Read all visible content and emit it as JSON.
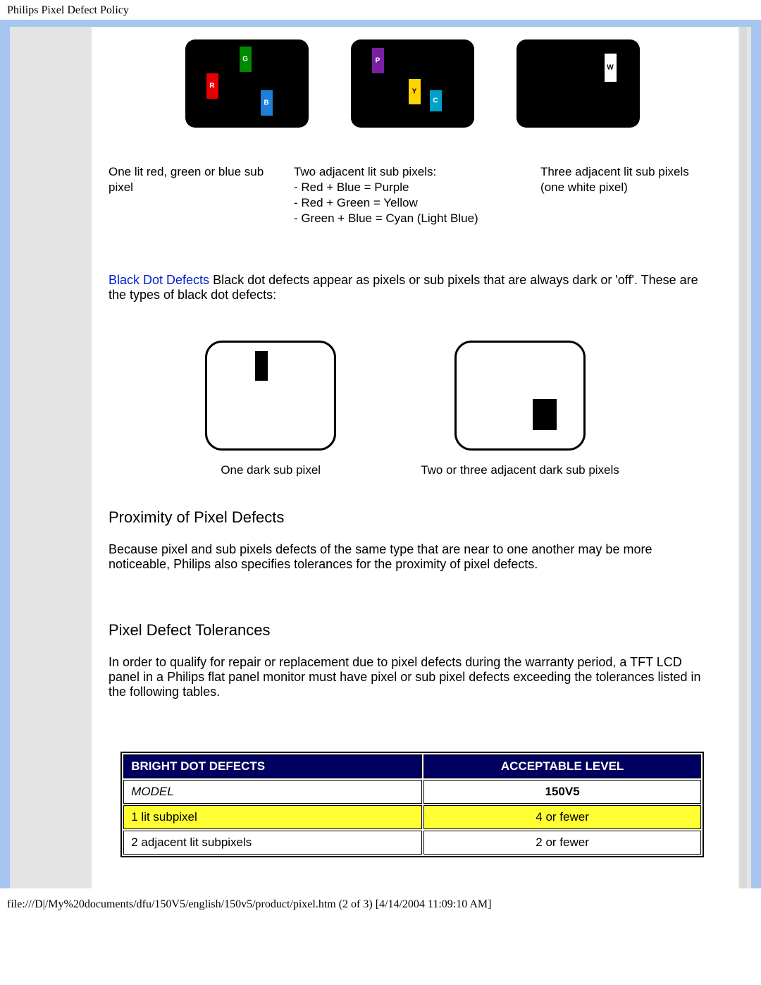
{
  "page": {
    "top_title": "Philips Pixel Defect Policy",
    "footer": "file:///D|/My%20documents/dfu/150V5/english/150v5/product/pixel.htm (2 of 3) [4/14/2004 11:09:10 AM]"
  },
  "bright_figs": {
    "labels": {
      "R": "R",
      "G": "G",
      "B": "B",
      "P": "P",
      "Y": "Y",
      "C": "C",
      "W": "W"
    },
    "captions": {
      "c1": "One lit red, green or blue sub pixel",
      "c2": "Two adjacent lit sub pixels:\n- Red + Blue = Purple\n- Red + Green = Yellow\n- Green + Blue = Cyan (Light Blue)",
      "c3": "Three adjacent lit sub pixels (one white pixel)"
    }
  },
  "black_dot": {
    "link": "Black Dot Defects",
    "text": " Black dot defects appear as pixels or sub pixels that are always dark or 'off'. These are the types of black dot defects:",
    "cap1": "One dark sub pixel",
    "cap2": "Two or three adjacent dark sub pixels"
  },
  "proximity": {
    "heading": "Proximity of Pixel Defects",
    "text": "Because pixel and sub pixels defects of the same type that are near to one another may be more noticeable, Philips also specifies tolerances for the proximity of pixel defects."
  },
  "tolerances": {
    "heading": "Pixel Defect Tolerances",
    "text": "In order to qualify for repair or replacement due to pixel defects during the warranty period, a TFT LCD panel in a Philips flat panel monitor must have pixel or sub pixel defects exceeding the tolerances listed in the following tables."
  },
  "table": {
    "h1": "BRIGHT DOT DEFECTS",
    "h2": "ACCEPTABLE LEVEL",
    "rows": [
      {
        "a": "MODEL",
        "b": "150V5"
      },
      {
        "a": "1 lit subpixel",
        "b": "4 or fewer"
      },
      {
        "a": "2 adjacent lit subpixels",
        "b": "2 or fewer"
      }
    ]
  }
}
